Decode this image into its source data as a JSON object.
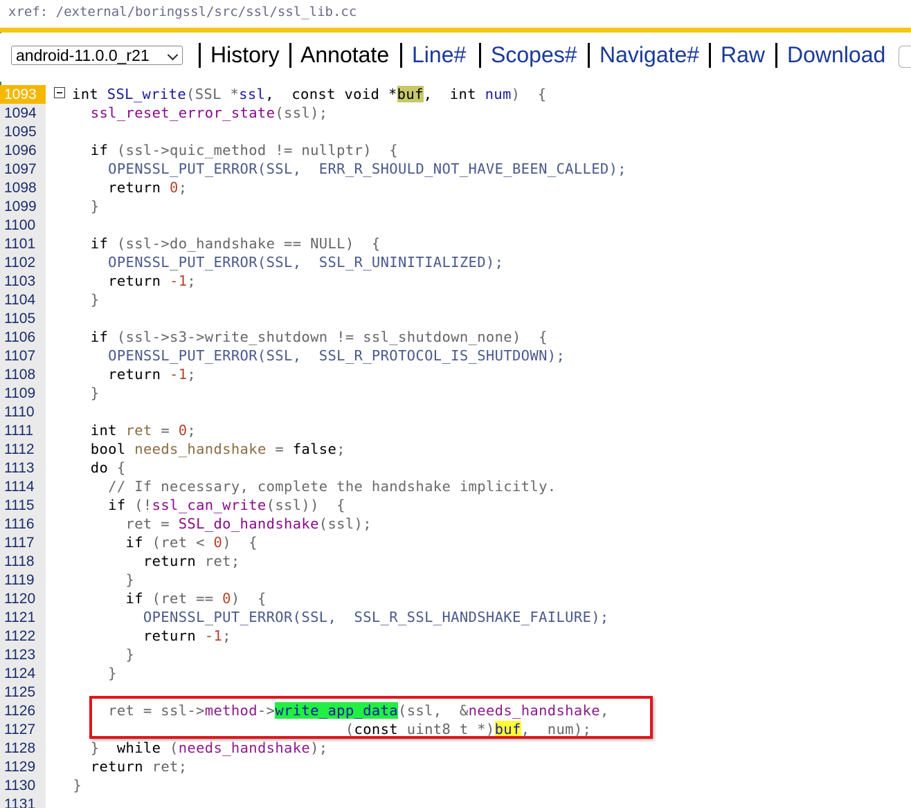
{
  "xref": {
    "path": "xref: /external/boringssl/src/ssl/ssl_lib.cc"
  },
  "toolbar": {
    "version_select": "android-11.0.0_r21",
    "items": [
      "History",
      "Annotate",
      "Line#",
      "Scopes#",
      "Navigate#",
      "Raw",
      "Download"
    ]
  },
  "colors": {
    "accent_bar": "#f5c518",
    "current_line": "#f5b700",
    "callout_box": "#e0161c",
    "green_highlight": "#22ee44",
    "yellow_highlight": "#ffff33"
  },
  "lines": [
    {
      "n": "1093",
      "current": true,
      "segs": [
        [
          "int ",
          "kw"
        ],
        [
          "SSL_write",
          "fnb"
        ],
        [
          "(SSL *",
          "gr"
        ],
        [
          "ssl",
          "fnb"
        ],
        [
          ",  const void *",
          "kw"
        ],
        [
          "buf",
          "hl-olive"
        ],
        [
          ",  int ",
          "kw"
        ],
        [
          "num",
          "fnb"
        ],
        [
          ")  {",
          "gr"
        ]
      ]
    },
    {
      "n": "1094",
      "segs": [
        [
          "    ",
          "gr"
        ],
        [
          "ssl_reset_error_state",
          "fn"
        ],
        [
          "(ssl);",
          "gr"
        ]
      ]
    },
    {
      "n": "1095",
      "segs": []
    },
    {
      "n": "1096",
      "segs": [
        [
          "    ",
          "gr"
        ],
        [
          "if ",
          "kw"
        ],
        [
          "(ssl->quic_method != nullptr)  {",
          "gr"
        ]
      ]
    },
    {
      "n": "1097",
      "segs": [
        [
          "      ",
          "gr"
        ],
        [
          "OPENSSL_PUT_ERROR(SSL,  ERR_R_SHOULD_NOT_HAVE_BEEN_CALLED);",
          "mac"
        ]
      ]
    },
    {
      "n": "1098",
      "segs": [
        [
          "      ",
          "gr"
        ],
        [
          "return ",
          "kw"
        ],
        [
          "0",
          "num"
        ],
        [
          ";",
          "gr"
        ]
      ]
    },
    {
      "n": "1099",
      "segs": [
        [
          "    }",
          "gr"
        ]
      ]
    },
    {
      "n": "1100",
      "segs": []
    },
    {
      "n": "1101",
      "segs": [
        [
          "    ",
          "gr"
        ],
        [
          "if ",
          "kw"
        ],
        [
          "(ssl->do_handshake == NULL)  {",
          "gr"
        ]
      ]
    },
    {
      "n": "1102",
      "segs": [
        [
          "      ",
          "gr"
        ],
        [
          "OPENSSL_PUT_ERROR(SSL,  SSL_R_UNINITIALIZED);",
          "mac"
        ]
      ]
    },
    {
      "n": "1103",
      "segs": [
        [
          "      ",
          "gr"
        ],
        [
          "return ",
          "kw"
        ],
        [
          "-1",
          "num"
        ],
        [
          ";",
          "gr"
        ]
      ]
    },
    {
      "n": "1104",
      "segs": [
        [
          "    }",
          "gr"
        ]
      ]
    },
    {
      "n": "1105",
      "segs": []
    },
    {
      "n": "1106",
      "segs": [
        [
          "    ",
          "gr"
        ],
        [
          "if ",
          "kw"
        ],
        [
          "(ssl->s3->write_shutdown != ssl_shutdown_none)  {",
          "gr"
        ]
      ]
    },
    {
      "n": "1107",
      "segs": [
        [
          "      ",
          "gr"
        ],
        [
          "OPENSSL_PUT_ERROR(SSL,  SSL_R_PROTOCOL_IS_SHUTDOWN);",
          "mac"
        ]
      ]
    },
    {
      "n": "1108",
      "segs": [
        [
          "      ",
          "gr"
        ],
        [
          "return ",
          "kw"
        ],
        [
          "-1",
          "num"
        ],
        [
          ";",
          "gr"
        ]
      ]
    },
    {
      "n": "1109",
      "segs": [
        [
          "    }",
          "gr"
        ]
      ]
    },
    {
      "n": "1110",
      "segs": []
    },
    {
      "n": "1111",
      "segs": [
        [
          "    ",
          "gr"
        ],
        [
          "int ",
          "kw"
        ],
        [
          "ret",
          "lv"
        ],
        [
          " = ",
          "gr"
        ],
        [
          "0",
          "num"
        ],
        [
          ";",
          "gr"
        ]
      ]
    },
    {
      "n": "1112",
      "segs": [
        [
          "    ",
          "gr"
        ],
        [
          "bool ",
          "kw"
        ],
        [
          "needs_handshake",
          "lv"
        ],
        [
          " = ",
          "gr"
        ],
        [
          "false",
          "kw"
        ],
        [
          ";",
          "gr"
        ]
      ]
    },
    {
      "n": "1113",
      "segs": [
        [
          "    ",
          "gr"
        ],
        [
          "do ",
          "kw"
        ],
        [
          "{",
          "gr"
        ]
      ]
    },
    {
      "n": "1114",
      "segs": [
        [
          "      ",
          "gr"
        ],
        [
          "// If necessary, complete the handshake implicitly.",
          "cm"
        ]
      ]
    },
    {
      "n": "1115",
      "segs": [
        [
          "      ",
          "gr"
        ],
        [
          "if ",
          "kw"
        ],
        [
          "(!",
          "gr"
        ],
        [
          "ssl_can_write",
          "fn"
        ],
        [
          "(ssl))  {",
          "gr"
        ]
      ]
    },
    {
      "n": "1116",
      "segs": [
        [
          "        ret = ",
          "gr"
        ],
        [
          "SSL_do_handshake",
          "fn"
        ],
        [
          "(ssl);",
          "gr"
        ]
      ]
    },
    {
      "n": "1117",
      "segs": [
        [
          "        ",
          "gr"
        ],
        [
          "if ",
          "kw"
        ],
        [
          "(ret < ",
          "gr"
        ],
        [
          "0",
          "num"
        ],
        [
          ")  {",
          "gr"
        ]
      ]
    },
    {
      "n": "1118",
      "segs": [
        [
          "          ",
          "gr"
        ],
        [
          "return ",
          "kw"
        ],
        [
          "ret;",
          "gr"
        ]
      ]
    },
    {
      "n": "1119",
      "segs": [
        [
          "        }",
          "gr"
        ]
      ]
    },
    {
      "n": "1120",
      "segs": [
        [
          "        ",
          "gr"
        ],
        [
          "if ",
          "kw"
        ],
        [
          "(ret == ",
          "gr"
        ],
        [
          "0",
          "num"
        ],
        [
          ")  {",
          "gr"
        ]
      ]
    },
    {
      "n": "1121",
      "segs": [
        [
          "          ",
          "gr"
        ],
        [
          "OPENSSL_PUT_ERROR(SSL,  SSL_R_SSL_HANDSHAKE_FAILURE);",
          "mac"
        ]
      ]
    },
    {
      "n": "1122",
      "segs": [
        [
          "          ",
          "gr"
        ],
        [
          "return ",
          "kw"
        ],
        [
          "-1",
          "num"
        ],
        [
          ";",
          "gr"
        ]
      ]
    },
    {
      "n": "1123",
      "segs": [
        [
          "        }",
          "gr"
        ]
      ]
    },
    {
      "n": "1124",
      "segs": [
        [
          "      }",
          "gr"
        ]
      ]
    },
    {
      "n": "1125",
      "segs": []
    },
    {
      "n": "1126",
      "segs": [
        [
          "      ret = ssl->",
          "gr"
        ],
        [
          "method",
          "id"
        ],
        [
          "->",
          "gr"
        ],
        [
          "write_app_data",
          "hl-green"
        ],
        [
          "(ssl,  &",
          "gr"
        ],
        [
          "needs_handshake",
          "id"
        ],
        [
          ",",
          "gr"
        ]
      ]
    },
    {
      "n": "1127",
      "segs": [
        [
          "                                 (",
          "gr"
        ],
        [
          "const ",
          "kw"
        ],
        [
          "uint8_t *)",
          "gr"
        ],
        [
          "buf",
          "hl-yellow"
        ],
        [
          ",  num);",
          "gr"
        ]
      ]
    },
    {
      "n": "1128",
      "segs": [
        [
          "    }  ",
          "gr"
        ],
        [
          "while ",
          "kw"
        ],
        [
          "(",
          "gr"
        ],
        [
          "needs_handshake",
          "id"
        ],
        [
          ");",
          "gr"
        ]
      ]
    },
    {
      "n": "1129",
      "segs": [
        [
          "    ",
          "gr"
        ],
        [
          "return ",
          "kw"
        ],
        [
          "ret;",
          "gr"
        ]
      ]
    },
    {
      "n": "1130",
      "segs": [
        [
          "  }",
          "gr"
        ]
      ]
    },
    {
      "n": "1131",
      "segs": []
    }
  ]
}
